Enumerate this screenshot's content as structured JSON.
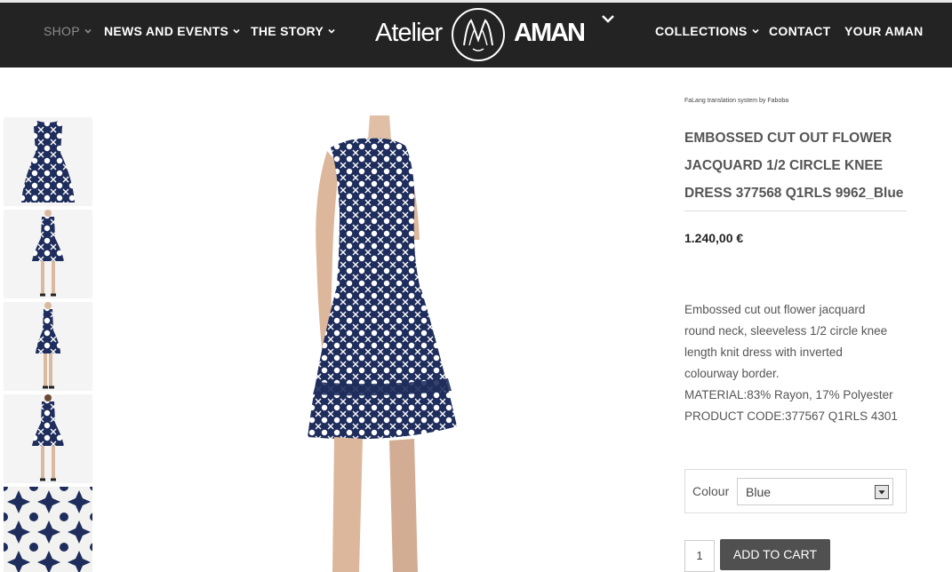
{
  "header": {
    "nav_left": [
      {
        "label": "SHOP",
        "has_dropdown": true,
        "active": false
      },
      {
        "label": "NEWS AND EVENTS",
        "has_dropdown": true
      },
      {
        "label": "THE STORY",
        "has_dropdown": true
      }
    ],
    "logo": {
      "left_text": "Atelier",
      "right_text": "AMAN"
    },
    "nav_right": [
      {
        "label": "COLLECTIONS",
        "has_dropdown": true
      },
      {
        "label": "CONTACT"
      },
      {
        "label": "YOUR AMAN"
      }
    ]
  },
  "product": {
    "credit": "FaLang translation system by Faboba",
    "title_lines": [
      "EMBOSSED CUT OUT FLOWER",
      "JACQUARD 1/2 CIRCLE KNEE",
      "DRESS 377568 Q1RLS 9962_Blue"
    ],
    "price": "1.240,00 €",
    "description_lines": [
      "Embossed cut out flower jacquard",
      "round neck, sleeveless 1/2 circle knee",
      "length knit dress with inverted",
      "colourway border.",
      "MATERIAL:83% Rayon, 17% Polyester",
      "PRODUCT CODE:377567 Q1RLS 4301"
    ],
    "colour_label": "Colour",
    "colour_value": "Blue",
    "quantity": "1",
    "add_to_cart": "ADD TO CART"
  },
  "colors": {
    "header_bg": "#232323",
    "pattern_navy": "#1e2d5c",
    "button_bg": "#505050"
  }
}
